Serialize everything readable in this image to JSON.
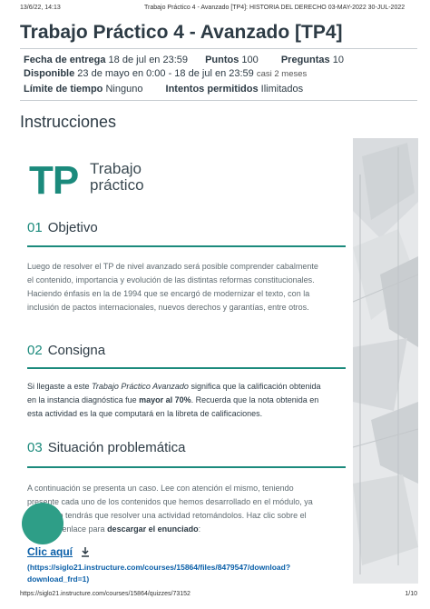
{
  "print_header": {
    "date": "13/6/22, 14:13",
    "title": "Trabajo Práctico 4 - Avanzado [TP4]: HISTORIA DEL DERECHO 03-MAY-2022 30-JUL-2022"
  },
  "quiz": {
    "title": "Trabajo Práctico 4 - Avanzado [TP4]",
    "due_label": "Fecha de entrega",
    "due_value": "18 de jul en 23:59",
    "points_label": "Puntos",
    "points_value": "100",
    "questions_label": "Preguntas",
    "questions_value": "10",
    "available_label": "Disponible",
    "available_value": "23 de mayo en 0:00 - 18 de jul en 23:59",
    "available_note": "casi 2 meses",
    "time_limit_label": "Límite de tiempo",
    "time_limit_value": "Ninguno",
    "attempts_label": "Intentos permitidos",
    "attempts_value": "Ilimitados"
  },
  "instructions": {
    "heading": "Instrucciones",
    "logo_letters": "TP",
    "logo_line1": "Trabajo",
    "logo_line2": "práctico",
    "sections": [
      {
        "number": "01",
        "title": "Objetivo",
        "lines": [
          "Luego de resolver el TP de nivel avanzado será posible comprender cabalmente",
          "el contenido, importancia y evolución de las distintas reformas constitucionales.",
          "Haciendo énfasis en la de 1994 que se encargó de modernizar el texto, con la",
          "inclusión de pactos internacionales, nuevos derechos y garantías, entre otros."
        ]
      },
      {
        "number": "02",
        "title": "Consigna",
        "p1_a": "Si llegaste a este ",
        "p1_italic": "Trabajo Práctico Avanzado",
        "p1_b": " significa que la calificación obtenida",
        "p2_a": "en la instancia diagnóstica fue ",
        "p2_bold": "mayor al 70%",
        "p2_b": ". Recuerda que la nota obtenida en",
        "p3": "esta actividad es la que computará en la libreta de calificaciones."
      },
      {
        "number": "03",
        "title": "Situación problemática",
        "line1": "A continuación se presenta un caso. Lee con atención el mismo, teniendo",
        "line2": "presente cada uno de los contenidos que hemos desarrollado en el módulo, ya",
        "line3": "que luego tendrás que resolver una actividad retomándolos. Haz clic sobre el",
        "line4_a": "siguiente enlace para ",
        "line4_bold": "descargar el enunciado",
        "line4_b": ":"
      }
    ],
    "link_label": "Clic aquí",
    "link_url_line1": "(https://siglo21.instructure.com/courses/15864/files/8479547/download?",
    "link_url_line2": "download_frd=1)"
  },
  "print_footer": {
    "url": "https://siglo21.instructure.com/courses/15864/quizzes/73152",
    "page": "1/10"
  },
  "colors": {
    "accent_teal": "#1b8a7c",
    "link_blue": "#0a5fa8",
    "fab_green": "#2e9e87"
  }
}
